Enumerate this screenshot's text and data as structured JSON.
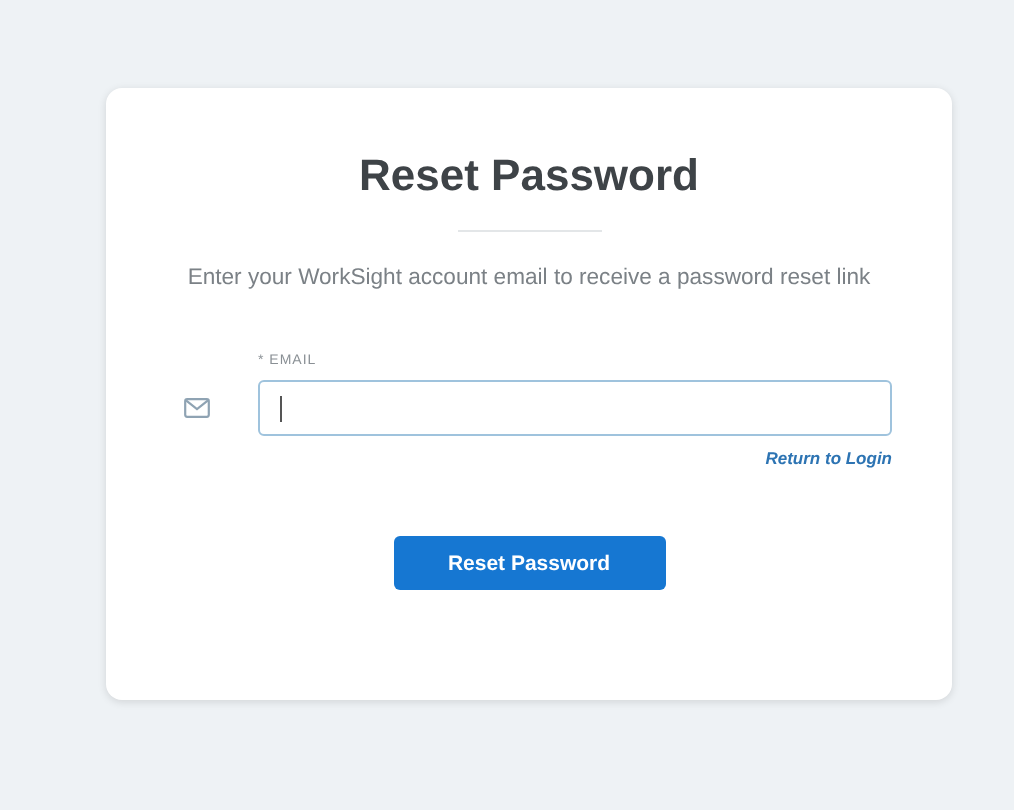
{
  "card": {
    "title": "Reset Password",
    "subtitle": "Enter your WorkSight account email to receive a password reset link",
    "email_field": {
      "label": "* EMAIL",
      "focused": true
    },
    "return_link": "Return to Login",
    "submit_button": "Reset Password"
  }
}
